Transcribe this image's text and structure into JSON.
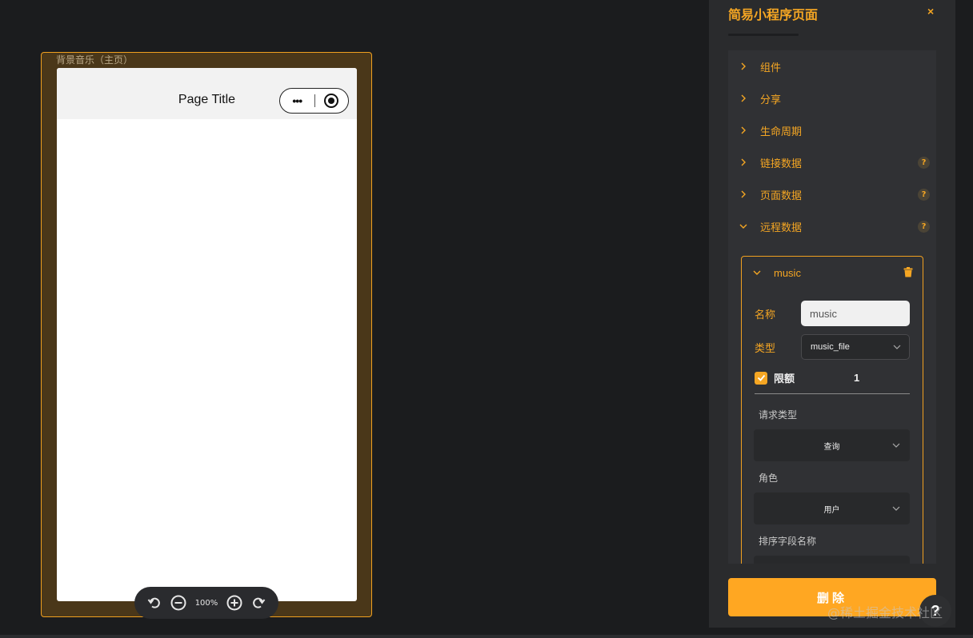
{
  "canvas": {
    "page_label": "背景音乐（主页）",
    "phone": {
      "title": "Page Title",
      "capsule_more": "•••"
    },
    "zoom": {
      "level": "100%"
    }
  },
  "panel": {
    "title": "简易小程序页面",
    "close": "×",
    "sections": [
      {
        "label": "组件",
        "help": false
      },
      {
        "label": "分享",
        "help": false
      },
      {
        "label": "生命周期",
        "help": false
      },
      {
        "label": "链接数据",
        "help": true
      },
      {
        "label": "页面数据",
        "help": true
      },
      {
        "label": "远程数据",
        "help": true,
        "expanded": true
      }
    ],
    "help_mark": "?",
    "remote_item": {
      "name": "music",
      "fields": {
        "name_label": "名称",
        "name_value": "music",
        "type_label": "类型",
        "type_value": "music_file",
        "limit_label": "限额",
        "limit_value": "1",
        "limit_checked": true,
        "request_type_label": "请求类型",
        "request_type_value": "查询",
        "role_label": "角色",
        "role_value": "用户",
        "sort_field_label": "排序字段名称"
      }
    },
    "delete_label": "删除"
  },
  "help_button": "?",
  "watermark": "@稀土掘金技术社区",
  "colors": {
    "accent": "#f5a623",
    "background": "#1b1c1e",
    "panel": "#2a2b2d"
  }
}
